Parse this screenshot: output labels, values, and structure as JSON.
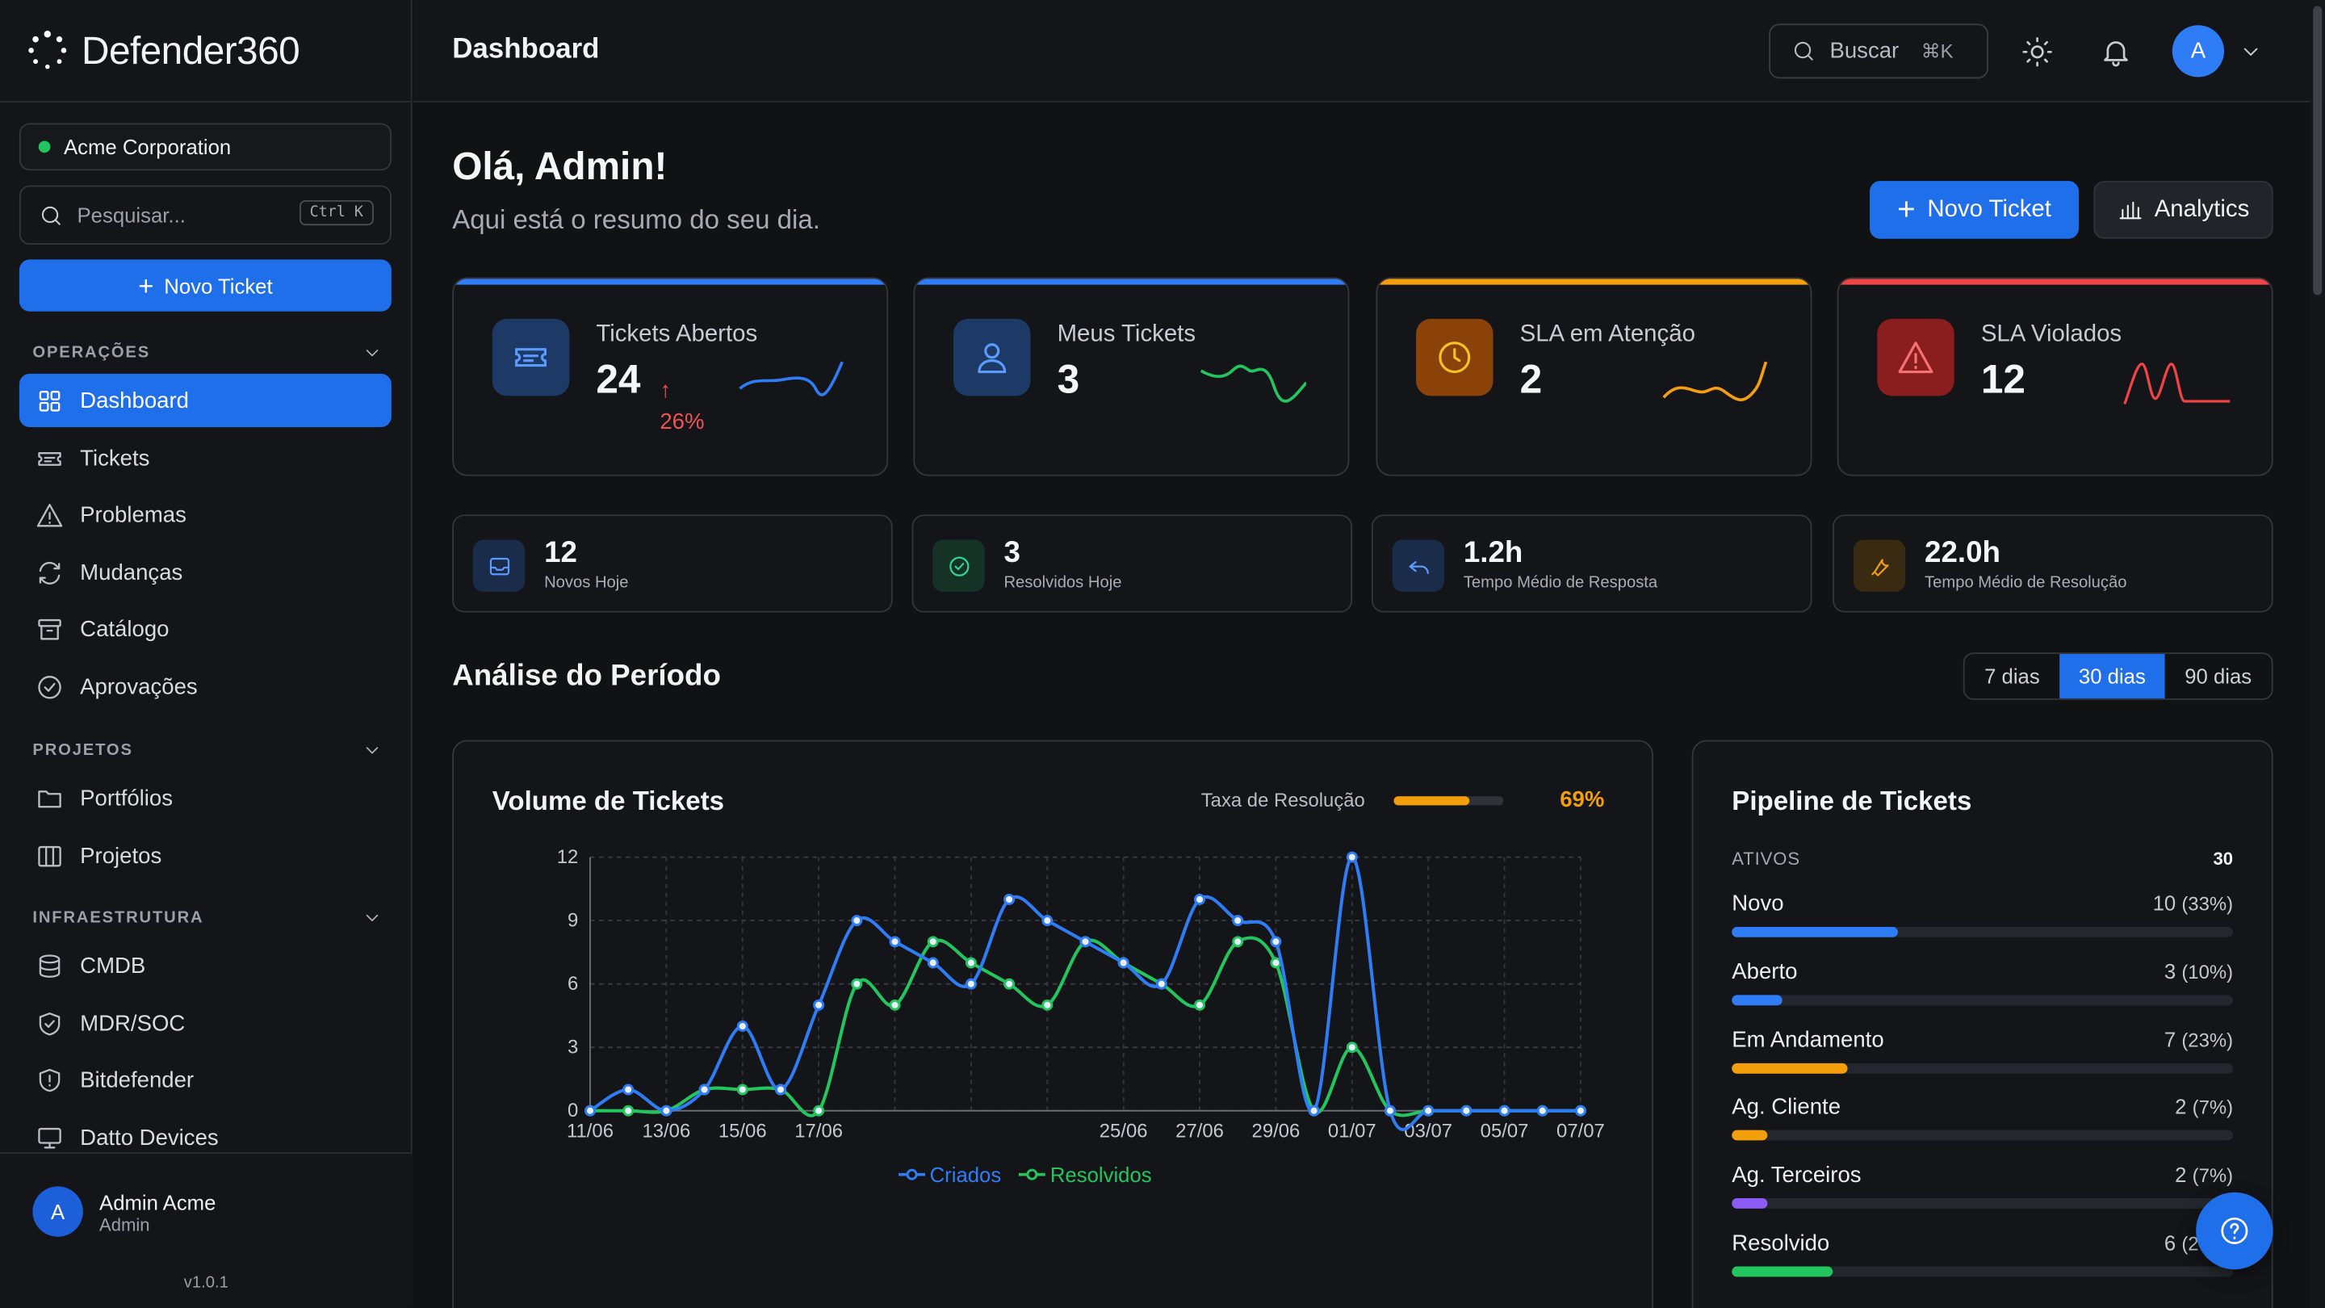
{
  "app": {
    "name": "Defender360",
    "version": "v1.0.1"
  },
  "sidebar": {
    "org": "Acme Corporation",
    "search_placeholder": "Pesquisar...",
    "search_shortcut": "Ctrl K",
    "new_ticket": "Novo Ticket",
    "sections": [
      {
        "title": "OPERAÇÕES",
        "items": [
          {
            "label": "Dashboard",
            "icon": "grid-icon",
            "active": true
          },
          {
            "label": "Tickets",
            "icon": "ticket-icon"
          },
          {
            "label": "Problemas",
            "icon": "alert-triangle-icon"
          },
          {
            "label": "Mudanças",
            "icon": "refresh-icon"
          },
          {
            "label": "Catálogo",
            "icon": "archive-icon"
          },
          {
            "label": "Aprovações",
            "icon": "check-circle-icon"
          }
        ]
      },
      {
        "title": "PROJETOS",
        "items": [
          {
            "label": "Portfólios",
            "icon": "folder-icon"
          },
          {
            "label": "Projetos",
            "icon": "columns-icon"
          }
        ]
      },
      {
        "title": "INFRAESTRUTURA",
        "items": [
          {
            "label": "CMDB",
            "icon": "database-icon"
          },
          {
            "label": "MDR/SOC",
            "icon": "shield-check-icon"
          },
          {
            "label": "Bitdefender",
            "icon": "shield-alert-icon"
          },
          {
            "label": "Datto Devices",
            "icon": "monitor-icon"
          }
        ]
      }
    ],
    "user": {
      "initial": "A",
      "name": "Admin Acme",
      "role": "Admin"
    }
  },
  "topbar": {
    "title": "Dashboard",
    "search": "Buscar",
    "search_shortcut": "⌘K",
    "avatar": "A"
  },
  "greeting": {
    "title": "Olá, Admin!",
    "subtitle": "Aqui está o resumo do seu dia."
  },
  "actions": {
    "new_ticket": "Novo Ticket",
    "analytics": "Analytics"
  },
  "kpis": [
    {
      "label": "Tickets Abertos",
      "value": "24",
      "trend": "26%",
      "color": "#2f7df6",
      "icon": "ticket-icon"
    },
    {
      "label": "Meus Tickets",
      "value": "3",
      "color": "#2f7df6",
      "icon": "user-icon"
    },
    {
      "label": "SLA em Atenção",
      "value": "2",
      "color": "#f59e0b",
      "icon": "clock-icon"
    },
    {
      "label": "SLA Violados",
      "value": "12",
      "color": "#ef4444",
      "icon": "alert-triangle-icon"
    }
  ],
  "stats": [
    {
      "value": "12",
      "label": "Novos Hoje",
      "icon": "inbox-icon"
    },
    {
      "value": "3",
      "label": "Resolvidos Hoje",
      "icon": "check-circle-icon"
    },
    {
      "value": "1.2h",
      "label": "Tempo Médio de Resposta",
      "icon": "reply-icon"
    },
    {
      "value": "22.0h",
      "label": "Tempo Médio de Resolução",
      "icon": "wrench-icon"
    }
  ],
  "analysis": {
    "title": "Análise do Período",
    "periods": [
      "7 dias",
      "30 dias",
      "90 dias"
    ],
    "active_period": "30 dias"
  },
  "volume": {
    "title": "Volume de Tickets",
    "resolution_label": "Taxa de Resolução",
    "resolution_value": "69%",
    "resolution_fraction": 0.69
  },
  "chart_data": {
    "type": "line",
    "title": "Volume de Tickets",
    "x": [
      "11/06",
      "12/06",
      "13/06",
      "14/06",
      "15/06",
      "16/06",
      "17/06",
      "18/06",
      "19/06",
      "20/06",
      "21/06",
      "22/06",
      "23/06",
      "24/06",
      "25/06",
      "26/06",
      "27/06",
      "28/06",
      "29/06",
      "30/06",
      "01/07",
      "02/07",
      "03/07",
      "04/07",
      "05/07",
      "06/07",
      "07/07"
    ],
    "x_tick_labels": [
      "11/06",
      "13/06",
      "15/06",
      "17/06",
      "25/06",
      "27/06",
      "29/06",
      "01/07",
      "03/07",
      "05/07",
      "07/07"
    ],
    "y_ticks": [
      0,
      3,
      6,
      9,
      12
    ],
    "ylim": [
      0,
      12
    ],
    "grid": true,
    "legend": "bottom",
    "series": [
      {
        "name": "Criados",
        "color": "#2f7df6",
        "values": [
          0,
          1,
          0,
          1,
          4,
          1,
          5,
          9,
          8,
          7,
          6,
          10,
          9,
          8,
          7,
          6,
          10,
          9,
          8,
          0,
          12,
          0,
          0,
          0,
          0,
          0,
          0
        ]
      },
      {
        "name": "Resolvidos",
        "color": "#22c55e",
        "values": [
          0,
          0,
          0,
          1,
          1,
          1,
          0,
          6,
          5,
          8,
          7,
          6,
          5,
          8,
          7,
          6,
          5,
          8,
          7,
          0,
          3,
          0,
          0,
          0,
          0,
          0,
          0
        ]
      }
    ]
  },
  "pipeline": {
    "title": "Pipeline de Tickets",
    "active_label": "ATIVOS",
    "active_total": "30",
    "rows": [
      {
        "label": "Novo",
        "count": "10",
        "pct": "(33%)",
        "fraction": 0.33,
        "color": "#2f7df6"
      },
      {
        "label": "Aberto",
        "count": "3",
        "pct": "(10%)",
        "fraction": 0.1,
        "color": "#2f7df6"
      },
      {
        "label": "Em Andamento",
        "count": "7",
        "pct": "(23%)",
        "fraction": 0.23,
        "color": "#f59e0b"
      },
      {
        "label": "Ag. Cliente",
        "count": "2",
        "pct": "(7%)",
        "fraction": 0.07,
        "color": "#f59e0b"
      },
      {
        "label": "Ag. Terceiros",
        "count": "2",
        "pct": "(7%)",
        "fraction": 0.07,
        "color": "#8b5cf6"
      },
      {
        "label": "Resolvido",
        "count": "6",
        "pct": "(20%)",
        "fraction": 0.2,
        "color": "#22c55e"
      }
    ]
  }
}
